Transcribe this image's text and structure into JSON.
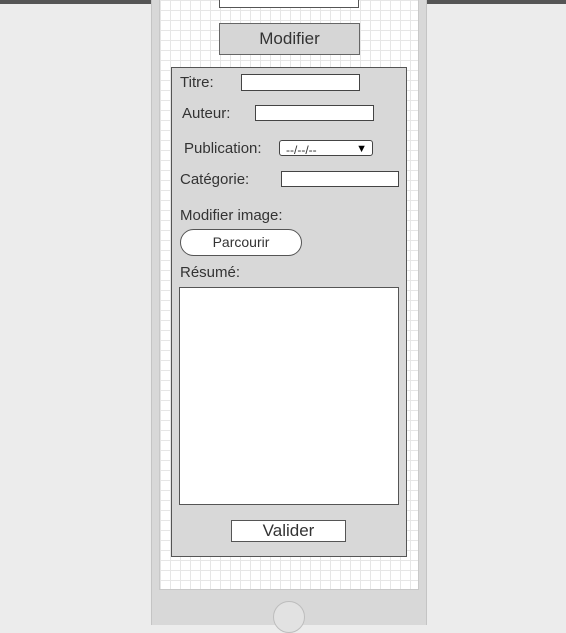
{
  "form": {
    "modify_button": "Modifier",
    "title_label": "Titre:",
    "author_label": "Auteur:",
    "publication_label": "Publication:",
    "publication_value": "--/--/--",
    "category_label": "Catégorie:",
    "modify_image_label": "Modifier image:",
    "browse_button": "Parcourir",
    "summary_label": "Résumé:",
    "submit_button": "Valider"
  },
  "icons": {
    "dropdown": "chevron-down-icon"
  }
}
